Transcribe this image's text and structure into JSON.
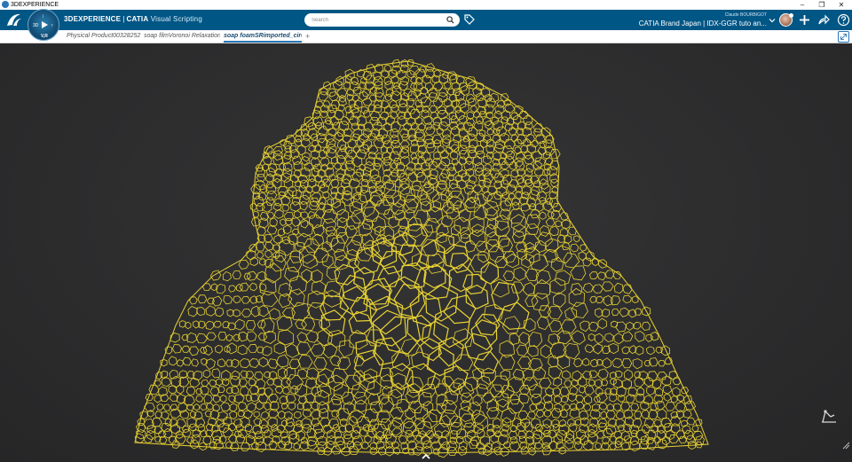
{
  "os": {
    "title": "3DEXPERIENCE",
    "controls": [
      "–",
      "❐",
      "✕"
    ]
  },
  "header": {
    "brand_bold": "3DEXPERIENCE",
    "brand_sep": "|",
    "brand_product": "CATIA",
    "brand_app": "Visual Scripting",
    "compass": {
      "label_3d": "3D",
      "label_v": "V,R",
      "label_i": "i",
      "label_r": "r"
    },
    "search_placeholder": "Search",
    "user_name": "Claude BOURBIGOT",
    "workspace": "CATIA Brand Japan | IDX-GGR tuto an..."
  },
  "tabs": [
    {
      "label": "Physical Product00328252",
      "active": false
    },
    {
      "label": "soap filmVoronoi Relaxation",
      "active": false
    },
    {
      "label": "soap foamSRimported_circ",
      "active": true
    }
  ],
  "tab_add_label": "+",
  "colors": {
    "header_bg": "#005685",
    "foam_stroke": "#e8d232",
    "viewport_bg": "#2c2c2d",
    "accent": "#2a77b5"
  },
  "icons": {
    "logo": "ds-logo-icon",
    "search": "search-icon",
    "tag": "tag-icon",
    "add": "plus-icon",
    "share": "share-icon",
    "help": "help-icon",
    "fullscreen": "fullscreen-icon",
    "robot": "robot-icon"
  }
}
